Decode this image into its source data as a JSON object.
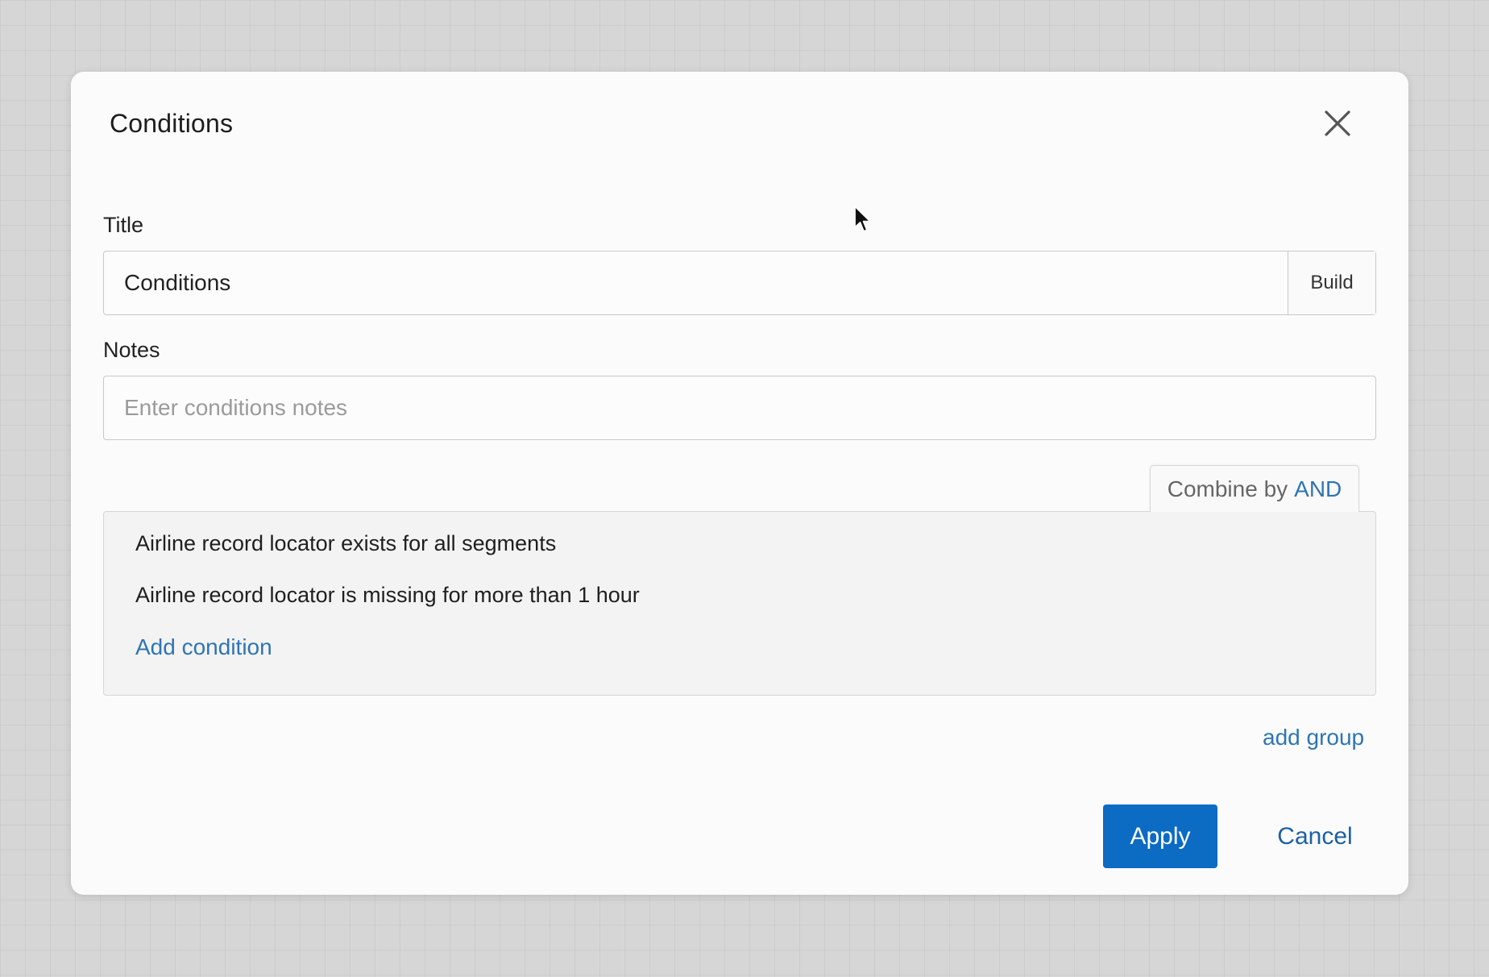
{
  "dialog": {
    "title": "Conditions",
    "close_icon": "close-icon"
  },
  "title_field": {
    "label": "Title",
    "value": "Conditions",
    "build_label": "Build"
  },
  "notes_field": {
    "label": "Notes",
    "value": "",
    "placeholder": "Enter conditions notes"
  },
  "group": {
    "combine_prefix": "Combine by",
    "combine_operator": "AND",
    "conditions": [
      "Airline record locator exists for all segments",
      "Airline record locator is missing for more than 1 hour"
    ],
    "add_condition_label": "Add condition"
  },
  "add_group_label": "add group",
  "actions": {
    "apply_label": "Apply",
    "cancel_label": "Cancel"
  },
  "colors": {
    "primary": "#0c6bc2",
    "link": "#2f75b2",
    "background": "#d6d6d6"
  }
}
